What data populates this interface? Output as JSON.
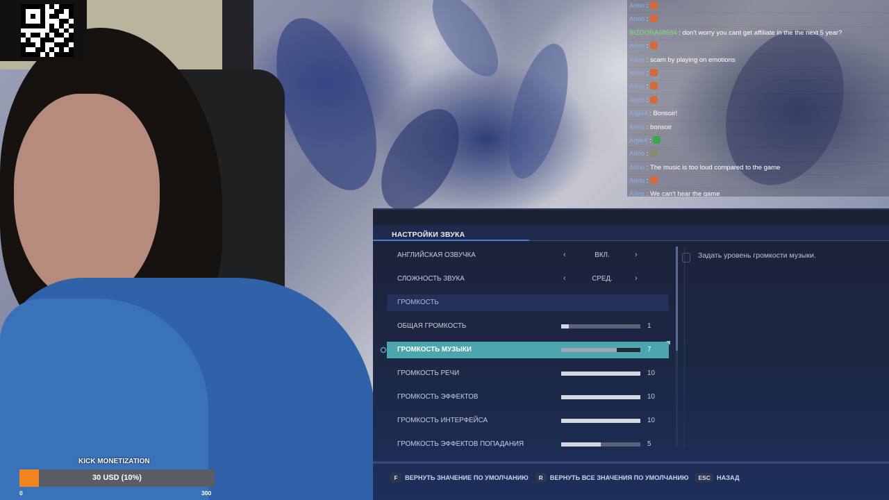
{
  "chat": {
    "messages": [
      {
        "user": "Arino",
        "user_color": "#8fb0e8",
        "text": "",
        "emote": "#d46a3a"
      },
      {
        "user": "Arino",
        "user_color": "#8fb0e8",
        "text": "",
        "emote": "#d46a3a"
      },
      {
        "user": "BIZDORA68584",
        "user_color": "#7fe07a",
        "text": "don't worry you cant get affiliate in the the next 5 year?",
        "emote": ""
      },
      {
        "user": "Arino",
        "user_color": "#8fb0e8",
        "text": "",
        "emote": "#d46a3a"
      },
      {
        "user": "Arino",
        "user_color": "#8fb0e8",
        "text": "scam by playing on emotions",
        "emote": ""
      },
      {
        "user": "Arino",
        "user_color": "#8fb0e8",
        "text": "",
        "emote": "#d46a3a"
      },
      {
        "user": "Arino",
        "user_color": "#8fb0e8",
        "text": "",
        "emote": "#d46a3a"
      },
      {
        "user": "Arino",
        "user_color": "#8fb0e8",
        "text": "",
        "emote": "#d46a3a"
      },
      {
        "user": "Aigle4",
        "user_color": "#8fb0e8",
        "text": "Bonsoir!",
        "emote": ""
      },
      {
        "user": "Arino",
        "user_color": "#8fb0e8",
        "text": "bonsoir",
        "emote": ""
      },
      {
        "user": "Aigle4",
        "user_color": "#8fb0e8",
        "text": "",
        "emote": "#3aa84a"
      },
      {
        "user": "Arino",
        "user_color": "#8fb0e8",
        "text": "",
        "emote": "#8a8a6a"
      },
      {
        "user": "Arino",
        "user_color": "#8fb0e8",
        "text": "The music is too loud compared to the game",
        "emote": ""
      },
      {
        "user": "Arino",
        "user_color": "#8fb0e8",
        "text": "",
        "emote": "#d46a3a"
      },
      {
        "user": "Arino",
        "user_color": "#8fb0e8",
        "text": "We can't hear the game",
        "emote": ""
      }
    ]
  },
  "settings": {
    "title": "НАСТРОЙКИ ЗВУКА",
    "description": "Задать уровень громкости музыки.",
    "rows": [
      {
        "label": "АНГЛИЙСКАЯ ОЗВУЧКА",
        "type": "choice",
        "value": "ВКЛ."
      },
      {
        "label": "СЛОЖНОСТЬ ЗВУКА",
        "type": "choice",
        "value": "СРЕД."
      },
      {
        "label": "ГРОМКОСТЬ",
        "type": "section"
      },
      {
        "label": "ОБЩАЯ ГРОМКОСТЬ",
        "type": "slider",
        "value": "1",
        "level": 0.1
      },
      {
        "label": "ГРОМКОСТЬ МУЗЫКИ",
        "type": "slider",
        "value": "7",
        "level": 0.7,
        "selected": true
      },
      {
        "label": "ГРОМКОСТЬ РЕЧИ",
        "type": "slider",
        "value": "10",
        "level": 1.0
      },
      {
        "label": "ГРОМКОСТЬ ЭФФЕКТОВ",
        "type": "slider",
        "value": "10",
        "level": 1.0
      },
      {
        "label": "ГРОМКОСТЬ ИНТЕРФЕЙСА",
        "type": "slider",
        "value": "10",
        "level": 1.0
      },
      {
        "label": "ГРОМКОСТЬ ЭФФЕКТОВ ПОПАДАНИЯ",
        "type": "slider",
        "value": "5",
        "level": 0.5
      }
    ],
    "footer": [
      {
        "key": "F",
        "label": "ВЕРНУТЬ ЗНАЧЕНИЕ ПО УМОЛЧАНИЮ"
      },
      {
        "key": "R",
        "label": "ВЕРНУТЬ ВСЕ ЗНАЧЕНИЯ ПО УМОЛЧАНИЮ"
      },
      {
        "key": "ESC",
        "label": "НАЗАД"
      }
    ]
  },
  "monetization": {
    "title": "KICK MONETIZATION",
    "progress_text": "30 USD (10%)",
    "progress": 0.1,
    "min": "0",
    "max": "300",
    "fill_color": "#f0851d"
  }
}
